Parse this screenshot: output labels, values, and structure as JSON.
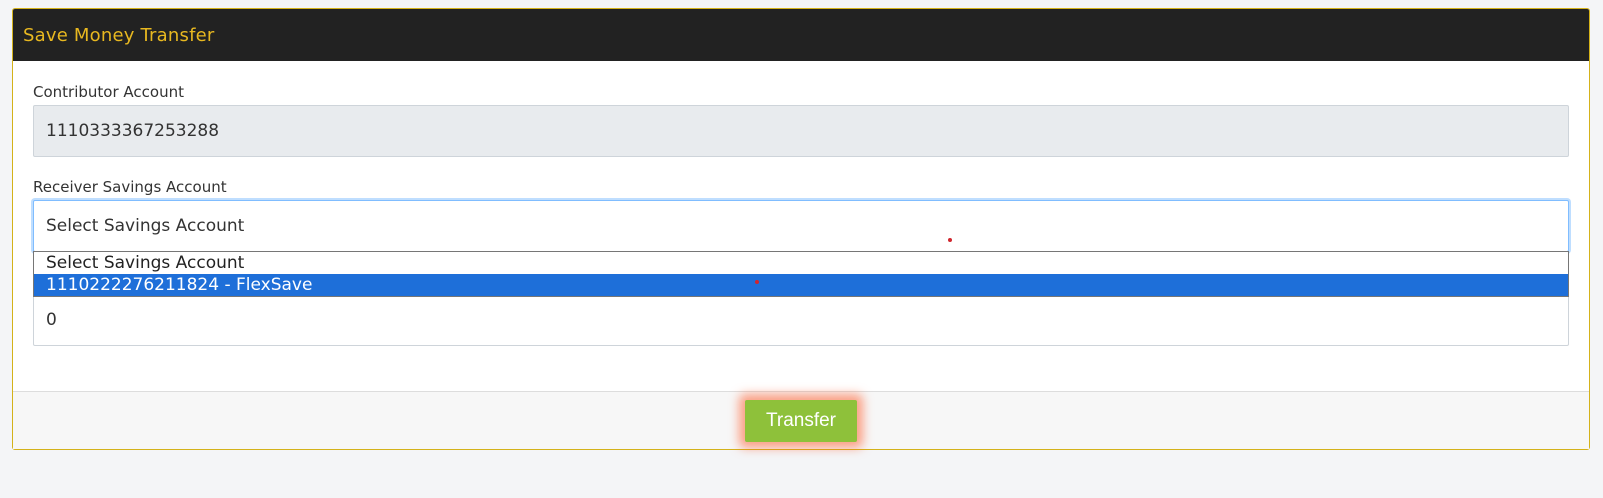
{
  "header": {
    "title": "Save Money Transfer"
  },
  "form": {
    "contributor_label": "Contributor Account",
    "contributor_value": "1110333367253288",
    "receiver_label": "Receiver Savings Account",
    "receiver_selected": "Select Savings Account",
    "receiver_options": [
      "Select Savings Account",
      "1110222276211824 - FlexSave"
    ],
    "amount_value": "0"
  },
  "footer": {
    "transfer_label": "Transfer"
  },
  "colors": {
    "header_bg": "#222222",
    "header_title": "#e8b820",
    "accent_border": "#d4b21a",
    "highlight_option": "#1e6fd9",
    "transfer_button": "#8ec13a"
  }
}
